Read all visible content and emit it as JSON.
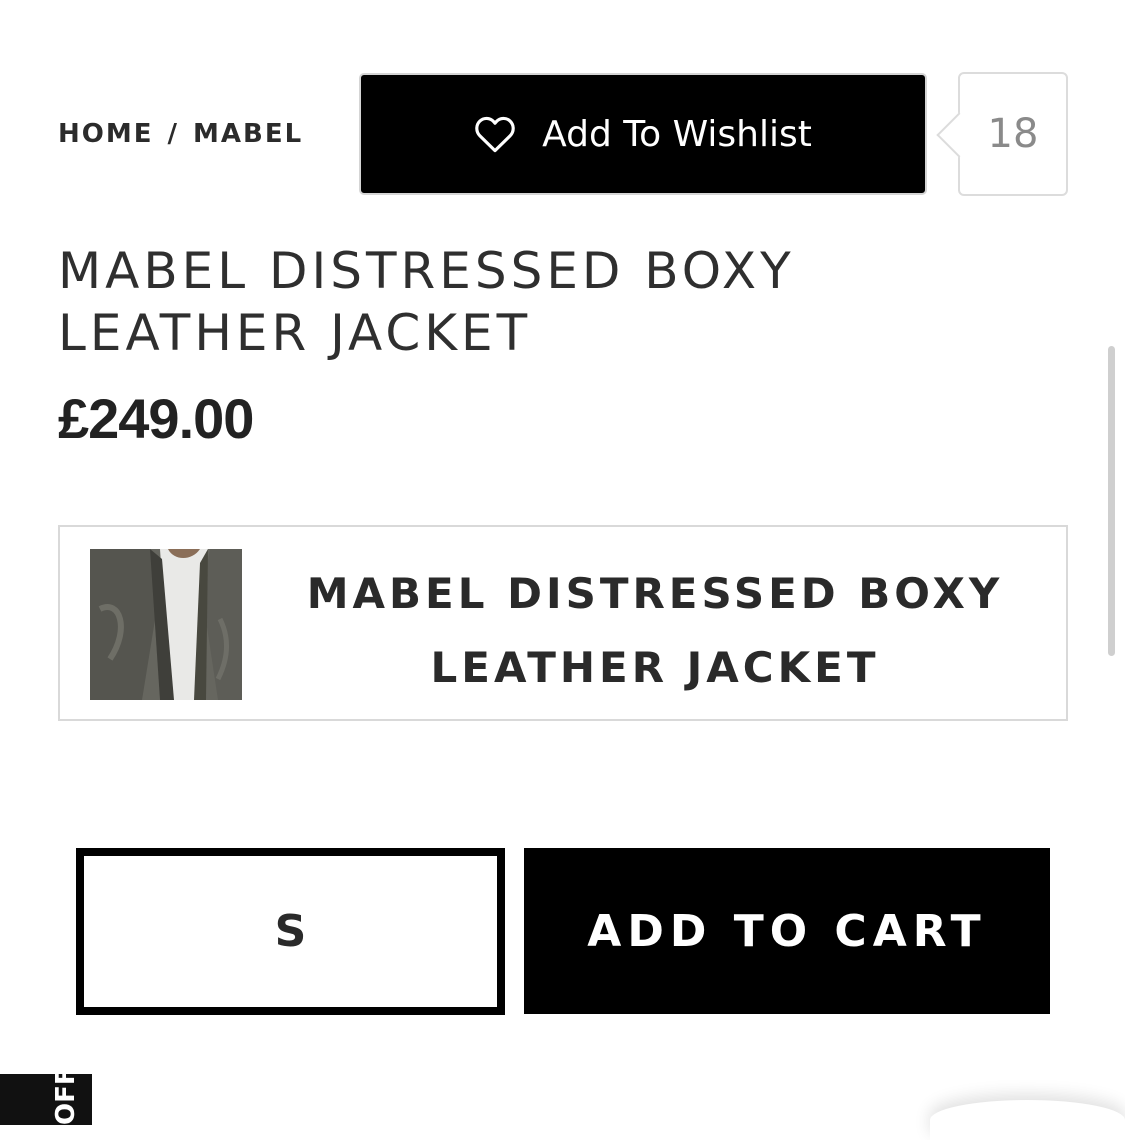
{
  "breadcrumb": {
    "home": "HOME",
    "separator": "/",
    "current": "MABEL"
  },
  "wishlist": {
    "label": "Add To Wishlist",
    "icon": "heart-outline-icon",
    "count": "18"
  },
  "product": {
    "title": "MABEL DISTRESSED BOXY LEATHER JACKET",
    "price": "£249.00"
  },
  "variant": {
    "title": "MABEL DISTRESSED BOXY LEATHER JACKET",
    "thumbnail_alt": "product-thumbnail"
  },
  "purchase": {
    "size_selected": "S",
    "add_to_cart_label": "ADD TO CART"
  },
  "promo_tab": {
    "label": "OFF"
  },
  "colors": {
    "button_bg": "#000000",
    "button_text": "#ffffff",
    "border_light": "#d9d9d9",
    "text_dark": "#222222",
    "count_text": "#8a8a8a"
  }
}
